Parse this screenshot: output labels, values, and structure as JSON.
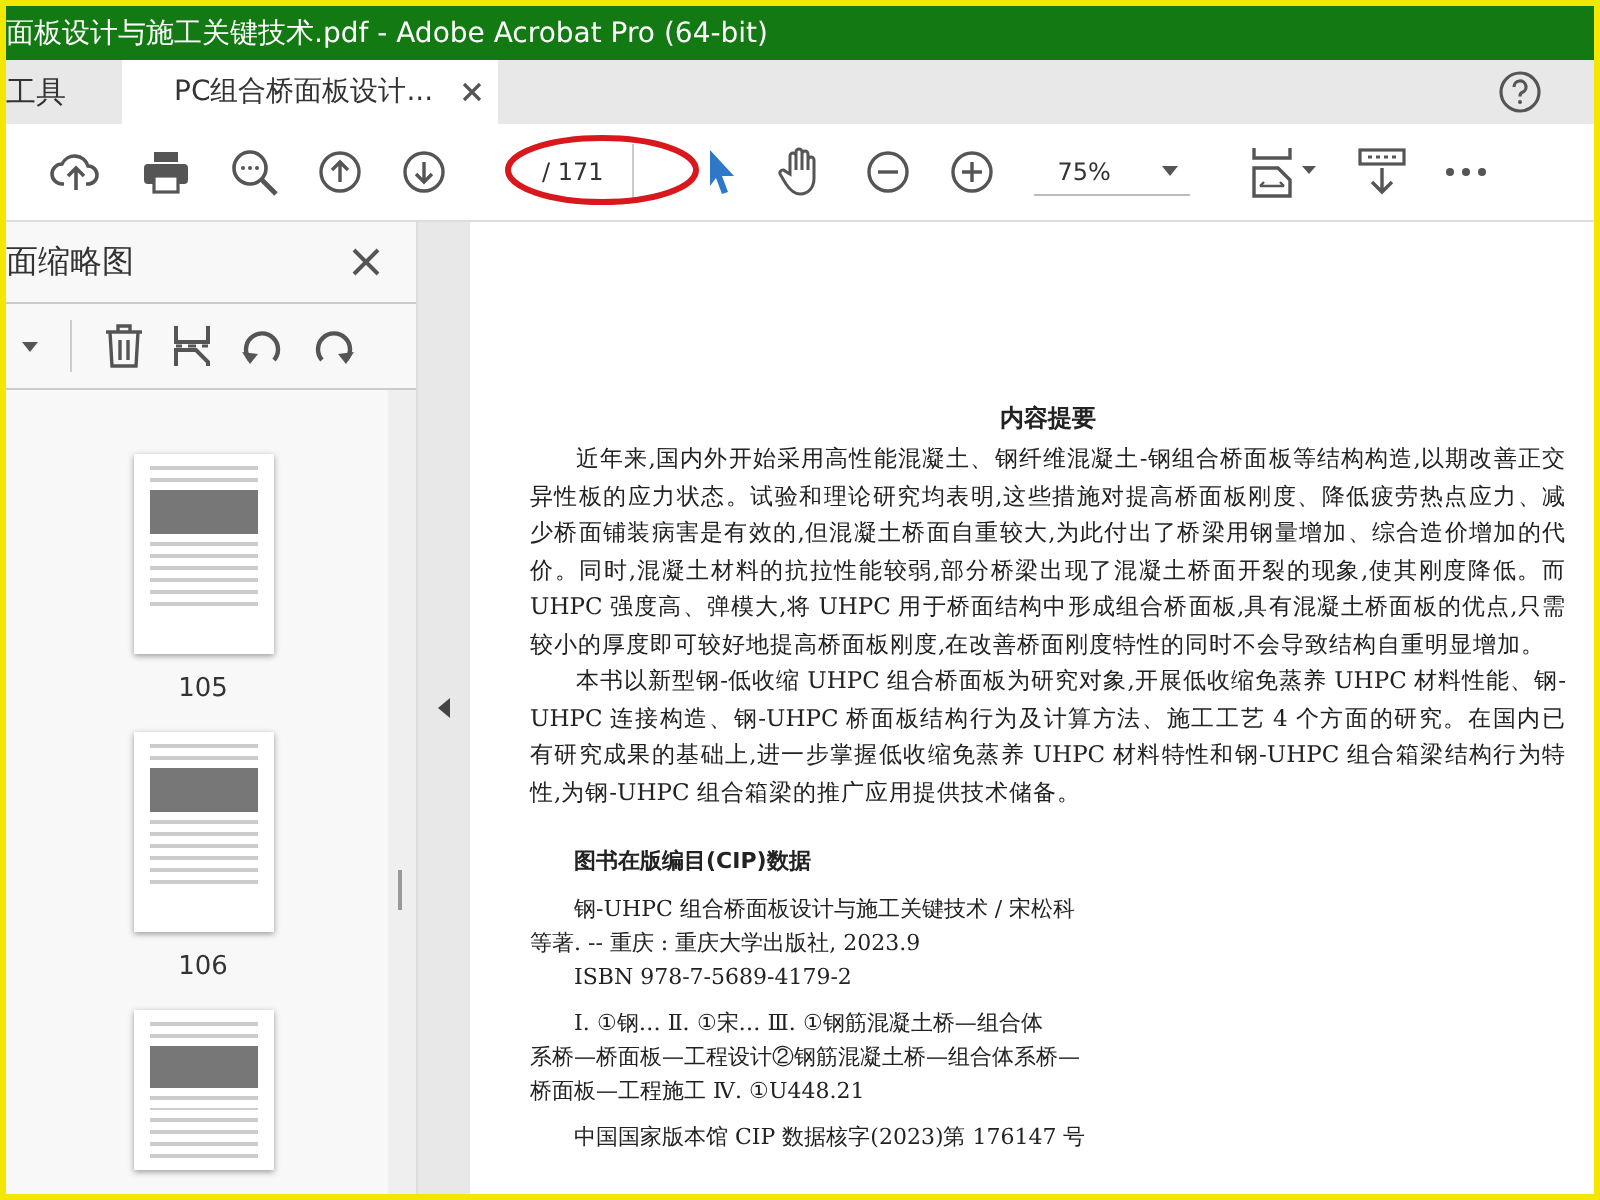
{
  "window": {
    "title": "面板设计与施工关键技术.pdf - Adobe Acrobat Pro (64-bit)"
  },
  "tabs": [
    {
      "label": "工具",
      "selected": false,
      "closable": false
    },
    {
      "label": "PC组合桥面板设计...",
      "selected": true,
      "closable": true
    }
  ],
  "toolbar": {
    "page_total": "/ 171",
    "zoom": "75%"
  },
  "sidebar": {
    "title": "面缩略图",
    "thumbnails": [
      {
        "label": "105",
        "cut_off": false
      },
      {
        "label": "106",
        "cut_off": false
      },
      {
        "cut_off": true
      }
    ]
  },
  "document": {
    "heading": "内容提要",
    "paragraphs": [
      "近年来,国内外开始采用高性能混凝土、钢纤维混凝土-钢组合桥面板等结构构造,以期改善正交异性板的应力状态。试验和理论研究均表明,这些措施对提高桥面板刚度、降低疲劳热点应力、减少桥面铺装病害是有效的,但混凝土桥面自重较大,为此付出了桥梁用钢量增加、综合造价增加的代价。同时,混凝土材料的抗拉性能较弱,部分桥梁出现了混凝土桥面开裂的现象,使其刚度降低。而 UHPC 强度高、弹模大,将 UHPC 用于桥面结构中形成组合桥面板,具有混凝土桥面板的优点,只需较小的厚度即可较好地提高桥面板刚度,在改善桥面刚度特性的同时不会导致结构自重明显增加。",
      "本书以新型钢-低收缩 UHPC 组合桥面板为研究对象,开展低收缩免蒸养 UHPC 材料性能、钢-UHPC 连接构造、钢-UHPC 桥面板结构行为及计算方法、施工工艺 4 个方面的研究。在国内已有研究成果的基础上,进一步掌握低收缩免蒸养 UHPC 材料特性和钢-UHPC 组合箱梁结构行为特性,为钢-UHPC 组合箱梁的推广应用提供技术储备。"
    ],
    "cip_heading": "图书在版编目(CIP)数据",
    "cip_lines": [
      {
        "text": "钢-UHPC 组合桥面板设计与施工关键技术 / 宋松科",
        "indent": true,
        "gap_before": false
      },
      {
        "text": "等著. -- 重庆 : 重庆大学出版社, 2023.9",
        "indent": false,
        "gap_before": false
      },
      {
        "text": "ISBN 978-7-5689-4179-2",
        "indent": true,
        "gap_before": false
      },
      {
        "text": "Ⅰ. ①钢… Ⅱ. ①宋… Ⅲ. ①钢筋混凝土桥—组合体",
        "indent": true,
        "gap_before": true
      },
      {
        "text": "系桥—桥面板—工程设计②钢筋混凝土桥—组合体系桥—",
        "indent": false,
        "gap_before": false
      },
      {
        "text": "桥面板—工程施工 Ⅳ. ①U448.21",
        "indent": false,
        "gap_before": false
      },
      {
        "text": "中国国家版本馆 CIP 数据核字(2023)第 176147 号",
        "indent": true,
        "gap_before": true
      }
    ]
  }
}
